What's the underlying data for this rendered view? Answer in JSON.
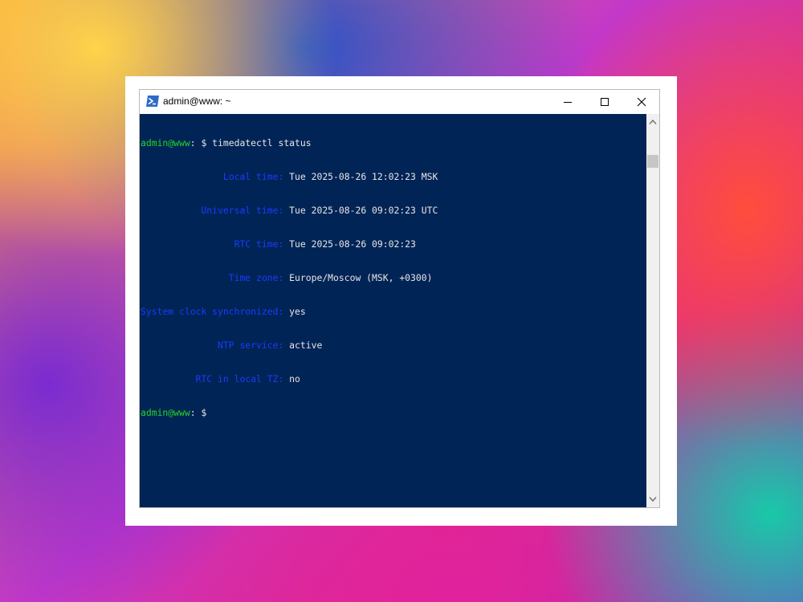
{
  "window": {
    "title": "admin@www: ~",
    "icon": "powershell-icon"
  },
  "terminal": {
    "colors": {
      "background": "#012456",
      "prompt": "#23d626",
      "label": "#1a3bff",
      "text": "#e6e6e6"
    },
    "prompt_user": "admin@www",
    "prompt_suffix": ": $ ",
    "command": "timedatectl status",
    "status": [
      {
        "label": "               Local time:",
        "value": " Tue 2025-08-26 12:02:23 MSK"
      },
      {
        "label": "           Universal time:",
        "value": " Tue 2025-08-26 09:02:23 UTC"
      },
      {
        "label": "                 RTC time:",
        "value": " Tue 2025-08-26 09:02:23"
      },
      {
        "label": "                Time zone:",
        "value": " Europe/Moscow (MSK, +0300)"
      },
      {
        "label": "System clock synchronized:",
        "value": " yes"
      },
      {
        "label": "              NTP service:",
        "value": " active"
      },
      {
        "label": "          RTC in local TZ:",
        "value": " no"
      }
    ],
    "final_prompt_suffix": ": $"
  }
}
